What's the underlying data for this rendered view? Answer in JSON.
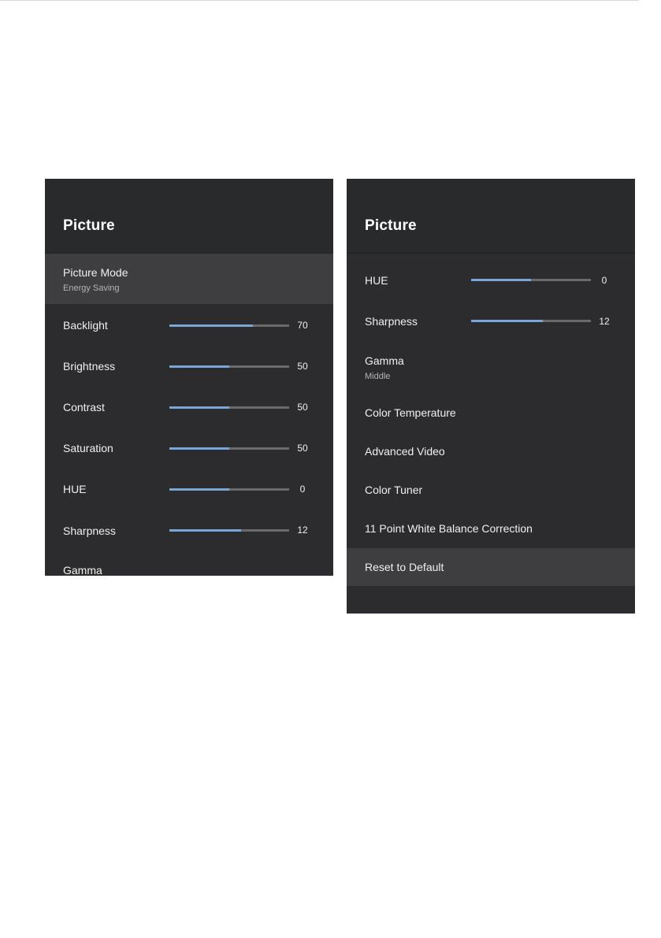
{
  "left_panel": {
    "title": "Picture",
    "picture_mode": {
      "label": "Picture Mode",
      "value": "Energy Saving"
    },
    "sliders": [
      {
        "label": "Backlight",
        "value": "70",
        "fraction": 0.7
      },
      {
        "label": "Brightness",
        "value": "50",
        "fraction": 0.5
      },
      {
        "label": "Contrast",
        "value": "50",
        "fraction": 0.5
      },
      {
        "label": "Saturation",
        "value": "50",
        "fraction": 0.5
      },
      {
        "label": "HUE",
        "value": "0",
        "fraction": 0.5
      },
      {
        "label": "Sharpness",
        "value": "12",
        "fraction": 0.6
      }
    ],
    "gamma_label": "Gamma"
  },
  "right_panel": {
    "title": "Picture",
    "sliders": [
      {
        "label": "HUE",
        "value": "0",
        "fraction": 0.5
      },
      {
        "label": "Sharpness",
        "value": "12",
        "fraction": 0.6
      }
    ],
    "gamma": {
      "label": "Gamma",
      "value": "Middle"
    },
    "items": [
      {
        "label": "Color Temperature"
      },
      {
        "label": "Advanced Video"
      },
      {
        "label": "Color Tuner"
      },
      {
        "label": "11 Point White Balance Correction"
      },
      {
        "label": "Reset to Default"
      }
    ]
  },
  "colors": {
    "panel_background": "#2c2c2e",
    "selected_row": "#3e3e40",
    "slider_fill": "#79a7d9",
    "slider_track": "#6a6a6c"
  }
}
